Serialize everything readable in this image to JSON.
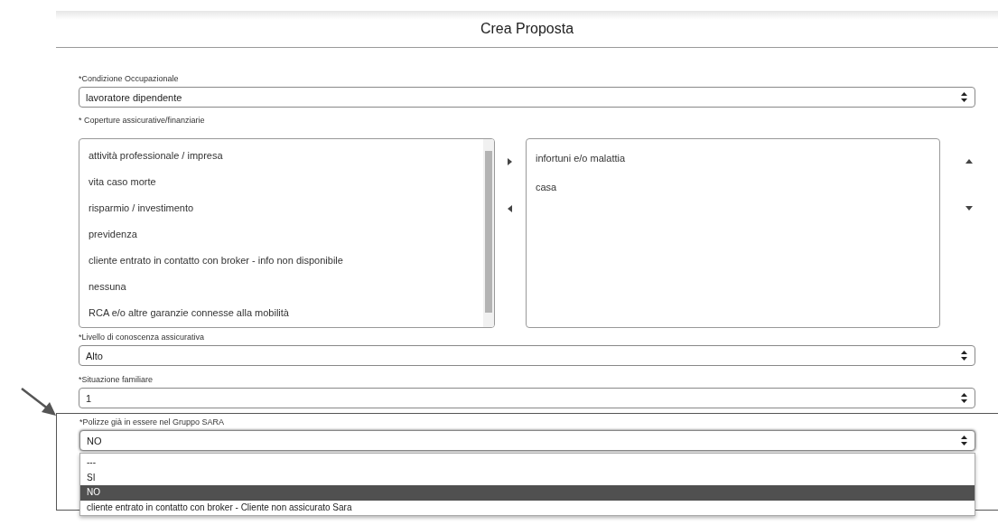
{
  "modal": {
    "title": "Crea Proposta"
  },
  "condizione": {
    "label": "*Condizione Occupazionale",
    "value": "lavoratore dipendente"
  },
  "coperture": {
    "label": "*  Coperture assicurative/finanziarie",
    "available": [
      "attività professionale / impresa",
      "vita caso morte",
      "risparmio / investimento",
      "previdenza",
      "cliente entrato in contatto con broker - info non disponibile",
      "nessuna",
      "RCA e/o altre garanzie connesse alla mobilità"
    ],
    "chosen": [
      "infortuni e/o malattia",
      "casa"
    ]
  },
  "livello": {
    "label": "*Livello di conoscenza assicurativa",
    "value": "Alto"
  },
  "situazione": {
    "label": "*Situazione familiare",
    "value": "1"
  },
  "polizze": {
    "label": "*Polizze già in essere nel Gruppo SARA",
    "value": "NO",
    "expanded": true,
    "options": [
      {
        "label": "---",
        "selected": false
      },
      {
        "label": "SI",
        "selected": false
      },
      {
        "label": "NO",
        "selected": true
      },
      {
        "label": "cliente entrato in contatto con broker - Cliente non assicurato Sara",
        "selected": false
      }
    ]
  }
}
